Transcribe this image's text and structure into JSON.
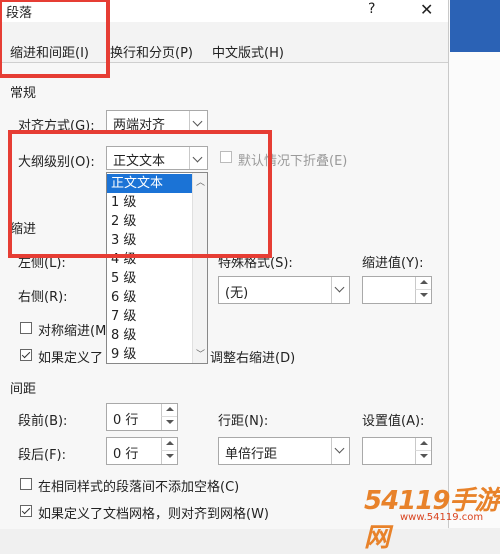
{
  "window": {
    "title": "段落",
    "help": "?"
  },
  "tabs": [
    {
      "label": "缩进和间距(I)"
    },
    {
      "label": "换行和分页(P)"
    },
    {
      "label": "中文版式(H)"
    }
  ],
  "general": {
    "section_label": "常规",
    "alignment_label": "对齐方式(G):",
    "alignment_value": "两端对齐",
    "outline_label": "大纲级别(O):",
    "outline_value": "正文文本",
    "collapsed_label": "默认情况下折叠(E)"
  },
  "outline_options": [
    "正文文本",
    "1 级",
    "2 级",
    "3 级",
    "4 级",
    "5 级",
    "6 级",
    "7 级",
    "8 级",
    "9 级"
  ],
  "indent": {
    "section_label": "缩进",
    "left_label": "左侧(L):",
    "right_label": "右侧(R):",
    "special_label": "特殊格式(S):",
    "special_value": "(无)",
    "indent_by_label": "缩进值(Y):",
    "mirror_label": "对称缩进(M)",
    "auto_adjust_prefix": "如果定义了",
    "auto_adjust_suffix": "调整右缩进(D)"
  },
  "spacing": {
    "section_label": "间距",
    "before_label": "段前(B):",
    "before_value": "0 行",
    "after_label": "段后(F):",
    "after_value": "0 行",
    "line_label": "行距(N):",
    "line_value": "单倍行距",
    "at_label": "设置值(A):",
    "no_space_label": "在相同样式的段落间不添加空格(C)",
    "snap_grid_label": "如果定义了文档网格，则对齐到网格(W)"
  },
  "watermark": {
    "text": "54119手游网",
    "sub": "www.54119.com"
  },
  "colors": {
    "annotation_red": "#e63d34",
    "selection_blue": "#1b73d6",
    "word_blue": "#2b62b5"
  }
}
